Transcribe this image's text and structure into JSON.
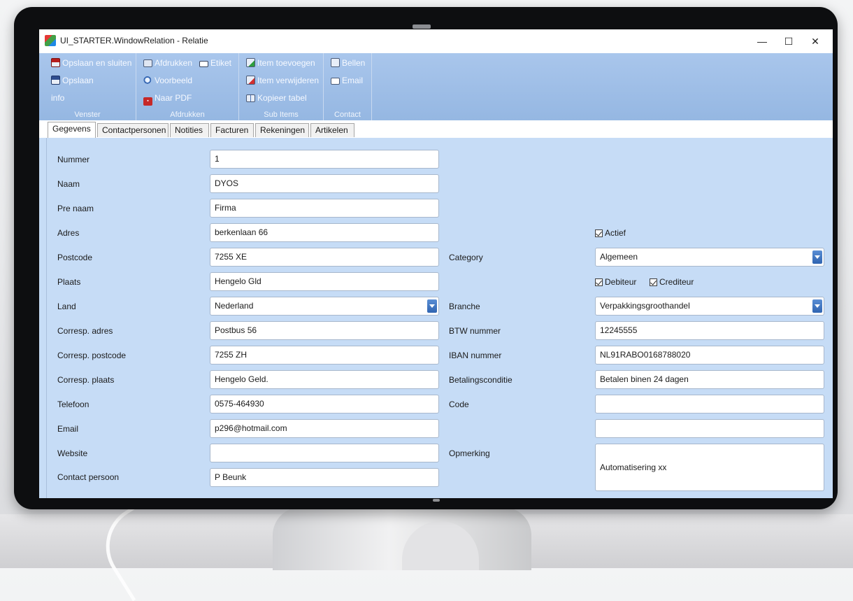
{
  "window": {
    "title": "UI_STARTER.WindowRelation - Relatie"
  },
  "ribbon": {
    "venster": {
      "label": "Venster",
      "save_close": "Opslaan en sluiten",
      "save": "Opslaan",
      "info": "info"
    },
    "afdrukken": {
      "label": "Afdrukken",
      "print": "Afdrukken",
      "label_btn": "Etiket",
      "preview": "Voorbeeld",
      "pdf": "Naar PDF"
    },
    "sub_items": {
      "label": "Sub Items",
      "add": "Item toevoegen",
      "remove": "Item verwijderen",
      "copy": "Kopieer tabel"
    },
    "contact": {
      "label": "Contact",
      "call": "Bellen",
      "email": "Email"
    }
  },
  "tabs": [
    "Gegevens",
    "Contactpersonen",
    "Notities",
    "Facturen",
    "Rekeningen",
    "Artikelen"
  ],
  "form_left": [
    {
      "label": "Nummer",
      "value": "1"
    },
    {
      "label": "Naam",
      "value": "DYOS"
    },
    {
      "label": "Pre naam",
      "value": "Firma"
    },
    {
      "label": "Adres",
      "value": "berkenlaan 66"
    },
    {
      "label": "Postcode",
      "value": "7255 XE"
    },
    {
      "label": "Plaats",
      "value": "Hengelo Gld"
    },
    {
      "label": "Land",
      "value": "Nederland"
    },
    {
      "label": "Corresp. adres",
      "value": "Postbus 56"
    },
    {
      "label": "Corresp. postcode",
      "value": "7255 ZH"
    },
    {
      "label": "Corresp. plaats",
      "value": "Hengelo Geld."
    },
    {
      "label": "Telefoon",
      "value": "0575-464930"
    },
    {
      "label": "Email",
      "value": "p296@hotmail.com"
    },
    {
      "label": "Website",
      "value": ""
    },
    {
      "label": "Contact persoon",
      "value": "P Beunk"
    }
  ],
  "form_right": {
    "actief": {
      "label": "Actief",
      "checked": true
    },
    "category": {
      "label": "Category",
      "value": "Algemeen"
    },
    "debiteur": {
      "label": "Debiteur",
      "checked": true
    },
    "crediteur": {
      "label": "Crediteur",
      "checked": true
    },
    "branche": {
      "label": "Branche",
      "value": "Verpakkingsgroothandel"
    },
    "btw": {
      "label": "BTW nummer",
      "value": "12245555"
    },
    "iban": {
      "label": "IBAN nummer",
      "value": "NL91RABO0168788020"
    },
    "betaling": {
      "label": "Betalingsconditie",
      "value": "Betalen binen 24 dagen"
    },
    "code": {
      "label": "Code",
      "value": ""
    },
    "extra": {
      "value": ""
    },
    "opmerking": {
      "label": "Opmerking",
      "value": "Automatisering xx"
    }
  },
  "window_controls": {
    "minimize": "—",
    "maximize": "☐",
    "close": "✕"
  }
}
